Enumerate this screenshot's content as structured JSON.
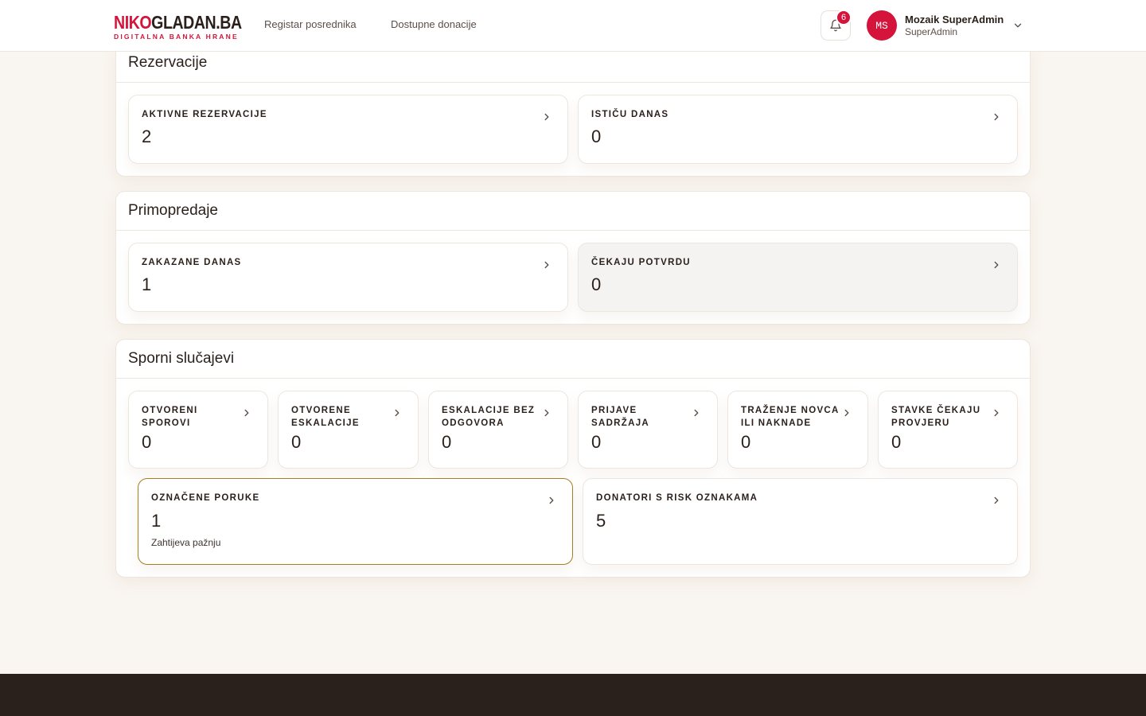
{
  "header": {
    "logo_part1": "NIKO",
    "logo_part2": "GLADAN.BA",
    "logo_tagline": "DIGITALNA BANKA HRANE",
    "nav": [
      "Registar posrednika",
      "Dostupne donacije"
    ],
    "notifications_count": "6",
    "user": {
      "initials": "MS",
      "name": "Mozaik SuperAdmin",
      "role": "SuperAdmin"
    }
  },
  "sections": {
    "rezervacije": {
      "title": "Rezervacije",
      "cards": [
        {
          "label": "AKTIVNE REZERVACIJE",
          "value": "2"
        },
        {
          "label": "ISTIČU DANAS",
          "value": "0"
        }
      ]
    },
    "primopredaje": {
      "title": "Primopredaje",
      "cards": [
        {
          "label": "ZAKAZANE DANAS",
          "value": "1"
        },
        {
          "label": "ČEKAJU POTVRDU",
          "value": "0"
        }
      ]
    },
    "sporni": {
      "title": "Sporni slučajevi",
      "cards": [
        {
          "label": "OTVORENI SPOROVI",
          "value": "0"
        },
        {
          "label": "OTVORENE ESKALACIJE",
          "value": "0"
        },
        {
          "label": "ESKALACIJE BEZ ODGOVORA",
          "value": "0"
        },
        {
          "label": "PRIJAVE SADRŽAJA",
          "value": "0"
        },
        {
          "label": "TRAŽENJE NOVCA ILI NAKNADE",
          "value": "0"
        },
        {
          "label": "STAVKE ČEKAJU PROVJERU",
          "value": "0"
        },
        {
          "label": "OZNAČENE PORUKE",
          "value": "1",
          "note": "Zahtijeva pažnju"
        },
        {
          "label": "DONATORI S RISK OZNAKAMA",
          "value": "5"
        }
      ]
    }
  },
  "colors": {
    "brand": "#d4143a",
    "alert_border": "#a47e1f",
    "footer": "#2a201c"
  }
}
